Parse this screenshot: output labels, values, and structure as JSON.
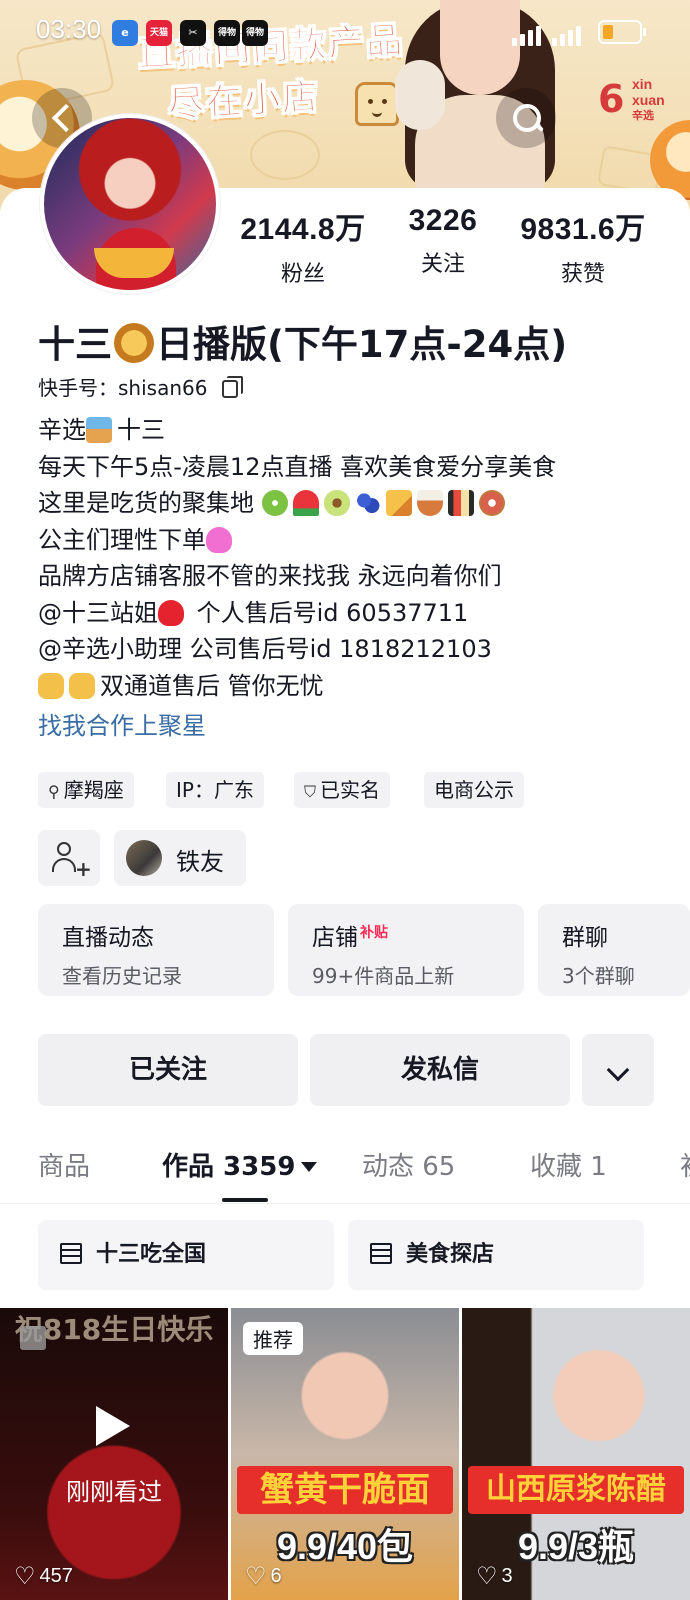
{
  "status_bar": {
    "time": "03:30",
    "apps": [
      "e",
      "天猫",
      "✂",
      "得物",
      "得物"
    ]
  },
  "banner": {
    "line1": "直播间同款产品",
    "line2": "尽在小店",
    "logo_text_1": "xin",
    "logo_text_2": "xuan",
    "logo_text_3": "辛选"
  },
  "profile": {
    "stats": [
      {
        "value": "2144.8万",
        "label": "粉丝"
      },
      {
        "value": "3226",
        "label": "关注"
      },
      {
        "value": "9831.6万",
        "label": "获赞"
      }
    ],
    "name_part1": "十三",
    "name_part2": "日播版(下午17点-24点)",
    "kuaishou_id": "快手号：shisan66",
    "bio_lines": [
      "辛选",
      "十三",
      "每天下午5点-凌晨12点直播 喜欢美食爱分享美食",
      "这里是吃货的聚集地",
      "公主们理性下单",
      "品牌方店铺客服不管的来找我 永远向着你们",
      "@十三站姐",
      " 个人售后号id 60537711",
      "@辛选小助理   公司售后号id 1818212103",
      "双通道售后 管你无忧"
    ],
    "link": "找我合作上聚星",
    "tags": [
      "摩羯座",
      "IP：广东",
      "已实名",
      "电商公示"
    ],
    "friend_label": "铁友",
    "cards": [
      {
        "title": "直播动态",
        "sub": "查看历史记录"
      },
      {
        "title": "店铺",
        "badge": "补贴",
        "sub": "99+件商品上新"
      },
      {
        "title": "群聊",
        "sub": "3个群聊"
      }
    ],
    "follow_button": "已关注",
    "message_button": "发私信"
  },
  "tabs": [
    {
      "label": "商品"
    },
    {
      "label": "作品 3359"
    },
    {
      "label": "动态 65"
    },
    {
      "label": "收藏 1"
    },
    {
      "label": "初"
    }
  ],
  "collections": [
    "十三吃全国",
    "美食探店"
  ],
  "videos": [
    {
      "header": "祝818生日快乐",
      "overlay": "刚刚看过",
      "likes": "457"
    },
    {
      "badge": "推荐",
      "title": "蟹黄干脆面",
      "price": "9.9/40包",
      "likes": "6"
    },
    {
      "title": "山西原浆陈醋",
      "price": "9.9/3瓶",
      "likes": "3"
    }
  ],
  "colors": {
    "accent_red": "#fe2c55",
    "link_blue": "#3a6da5",
    "banner_text": "#e24a2b"
  }
}
